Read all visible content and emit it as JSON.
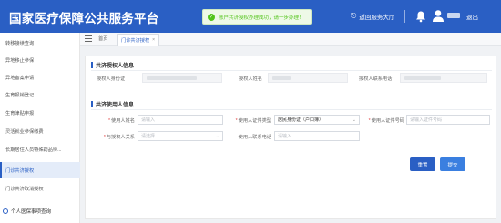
{
  "header": {
    "app_title": "国家医疗保障公共服务平台",
    "toast_message": "账户共济授权办理成功，请一步办理！",
    "return_label": "返回服务大厅",
    "logout_label": "退出"
  },
  "sidebar": {
    "items": [
      {
        "label": "转移接续查询"
      },
      {
        "label": "异地移止参保"
      },
      {
        "label": "异地备案申请"
      },
      {
        "label": "生育报销登记"
      },
      {
        "label": "生育津贴申报"
      },
      {
        "label": "灵活就业参保缴费"
      },
      {
        "label": "长期居住人员特殊药品待..."
      },
      {
        "label": "门诊共济授权",
        "active": true
      },
      {
        "label": "门诊共济取消授权"
      }
    ],
    "group_label": "个人医保事项查询"
  },
  "tabs": {
    "home_label": "首页",
    "active_label": "门诊共济授权"
  },
  "form": {
    "authorizer_section_title": "共济授权人信息",
    "authorizer_fields": [
      {
        "label": "授权人身份证"
      },
      {
        "label": "授权人姓名"
      },
      {
        "label": "授权人联系电话"
      }
    ],
    "user_section_title": "共济使用人信息",
    "user_name": {
      "label": "使用人姓名",
      "placeholder": "请输入"
    },
    "user_id_type": {
      "label": "使用人证件类型",
      "value": "居民身份证（户口簿）"
    },
    "user_id_number": {
      "label": "使用人证件号码",
      "placeholder": "请输入证件号码"
    },
    "relation": {
      "label": "与授权人关系",
      "placeholder": "请选择"
    },
    "user_phone": {
      "label": "使用人联系电话",
      "placeholder": "请输入"
    },
    "reset_label": "重置",
    "submit_label": "提交"
  },
  "colors": {
    "primary": "#2a5fc4",
    "success": "#52c41a",
    "required": "#e23c3c"
  }
}
